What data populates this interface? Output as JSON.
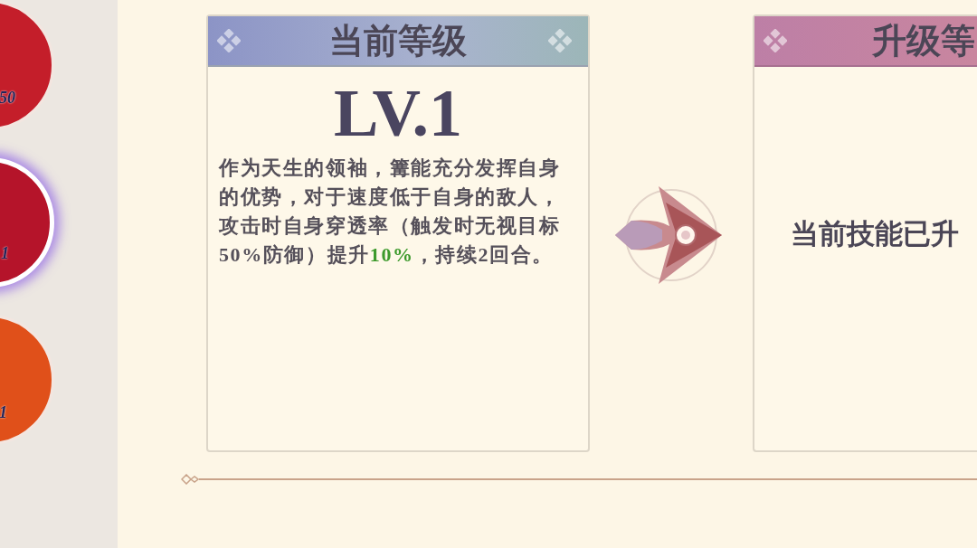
{
  "skills": [
    {
      "level": "50",
      "selected": false,
      "color": "#c41e2a"
    },
    {
      "level": "1",
      "selected": true,
      "color": "#b5142a"
    },
    {
      "level": "1",
      "selected": false,
      "color": "#e0501a"
    }
  ],
  "cards": [
    {
      "kind": "current",
      "title": "当前等级",
      "level": "LV.1",
      "description": [
        {
          "text": "作为天生的领袖，篝能充分发挥自身的优势，对于速度低于自身的敌人，攻击时自身穿透率（触发时无视目标50%防御）提升",
          "highlight": false
        },
        {
          "text": "10%",
          "highlight": true
        },
        {
          "text": "，持续2回合。",
          "highlight": false
        }
      ]
    },
    {
      "kind": "next",
      "title": "升级等",
      "message": "当前技能已升"
    }
  ]
}
